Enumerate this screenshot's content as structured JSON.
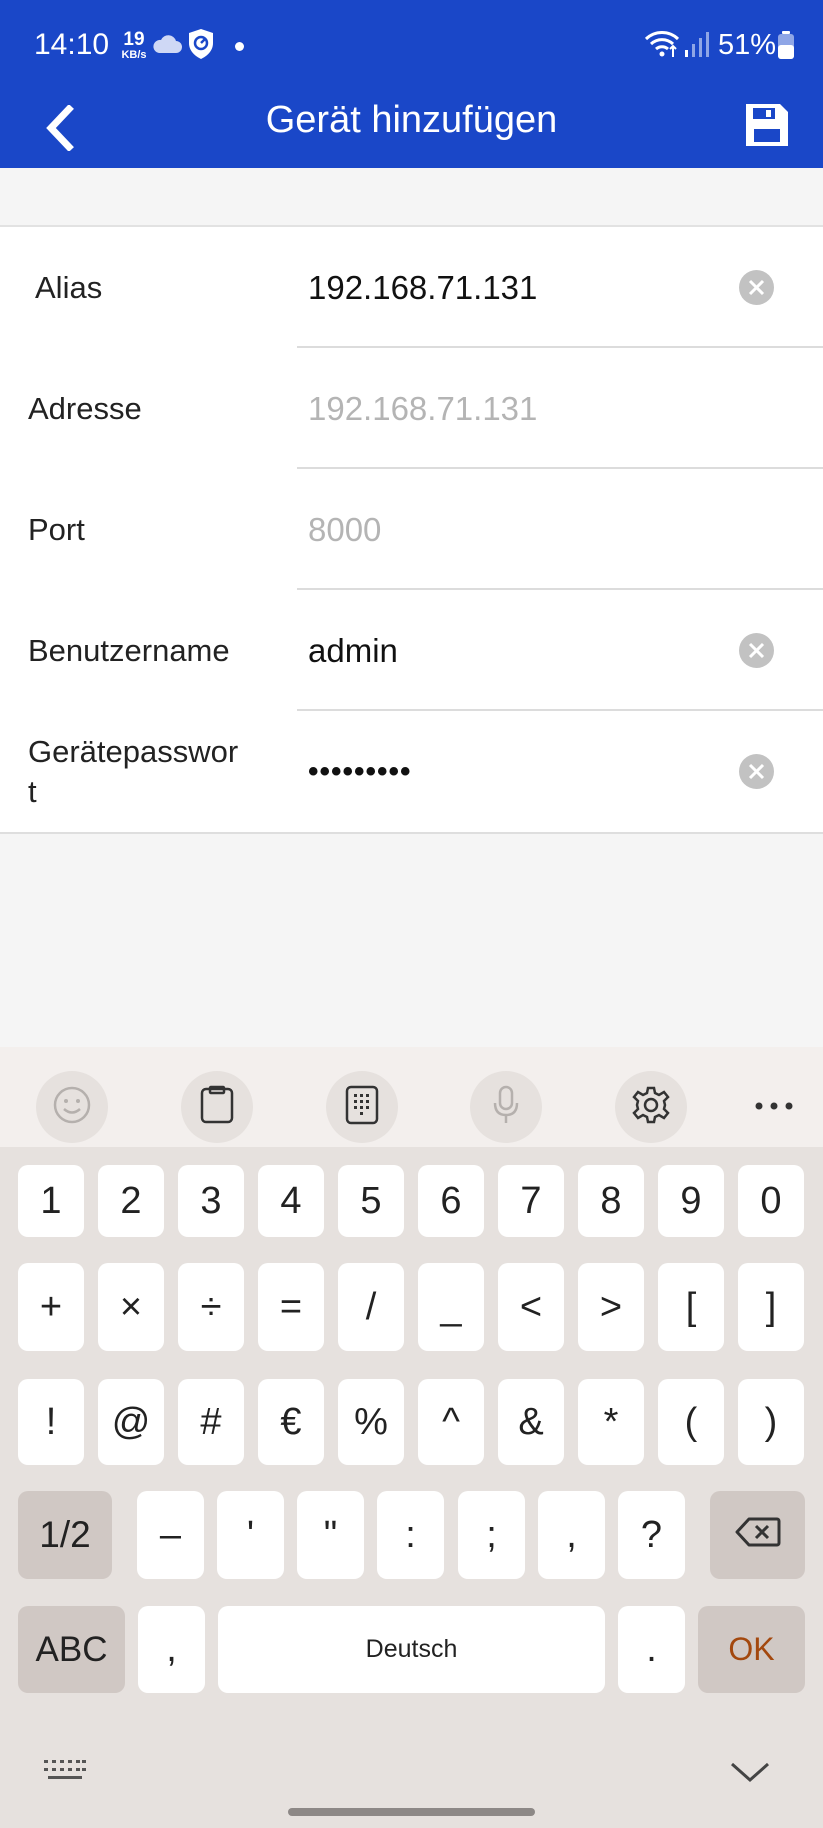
{
  "status_bar": {
    "time": "14:10",
    "speed_value": "19",
    "speed_unit": "KB/s",
    "battery": "51%",
    "icons": [
      "cloud-icon",
      "shield-icon",
      "notification-dot",
      "wifi-icon",
      "signal-icon",
      "battery-icon"
    ]
  },
  "app_bar": {
    "title": "Gerät hinzufügen",
    "left_icon": "back-icon",
    "right_icon": "save-icon",
    "color": "#1a47c8"
  },
  "form": {
    "fields": [
      {
        "label": "Alias",
        "value": "192.168.71.131",
        "placeholder": false,
        "clearable": true
      },
      {
        "label": "Adresse",
        "value": "192.168.71.131",
        "placeholder": true,
        "clearable": false
      },
      {
        "label": "Port",
        "value": "8000",
        "placeholder": true,
        "clearable": false
      },
      {
        "label": "Benutzername",
        "value": "admin",
        "placeholder": false,
        "clearable": true
      },
      {
        "label": "Gerätepasswor\nt",
        "value": "•••••••••",
        "placeholder": false,
        "clearable": true
      }
    ]
  },
  "keyboard": {
    "toolbar": [
      "emoji-icon",
      "clipboard-icon",
      "keypad-icon",
      "microphone-icon",
      "settings-icon",
      "more-icon"
    ],
    "row1": [
      "1",
      "2",
      "3",
      "4",
      "5",
      "6",
      "7",
      "8",
      "9",
      "0"
    ],
    "row2": [
      "+",
      "×",
      "÷",
      "=",
      "/",
      "_",
      "<",
      ">",
      "[",
      "]"
    ],
    "row3": [
      "!",
      "@",
      "#",
      "€",
      "%",
      "^",
      "&",
      "*",
      "(",
      ")"
    ],
    "row4": {
      "shift": "1/2",
      "keys": [
        "–",
        "'",
        "\"",
        ":",
        ";",
        ",",
        "?"
      ]
    },
    "row5": {
      "abc": "ABC",
      "comma": ",",
      "space": "Deutsch",
      "period": ".",
      "ok": "OK"
    },
    "ok_color": "#a3480e"
  }
}
